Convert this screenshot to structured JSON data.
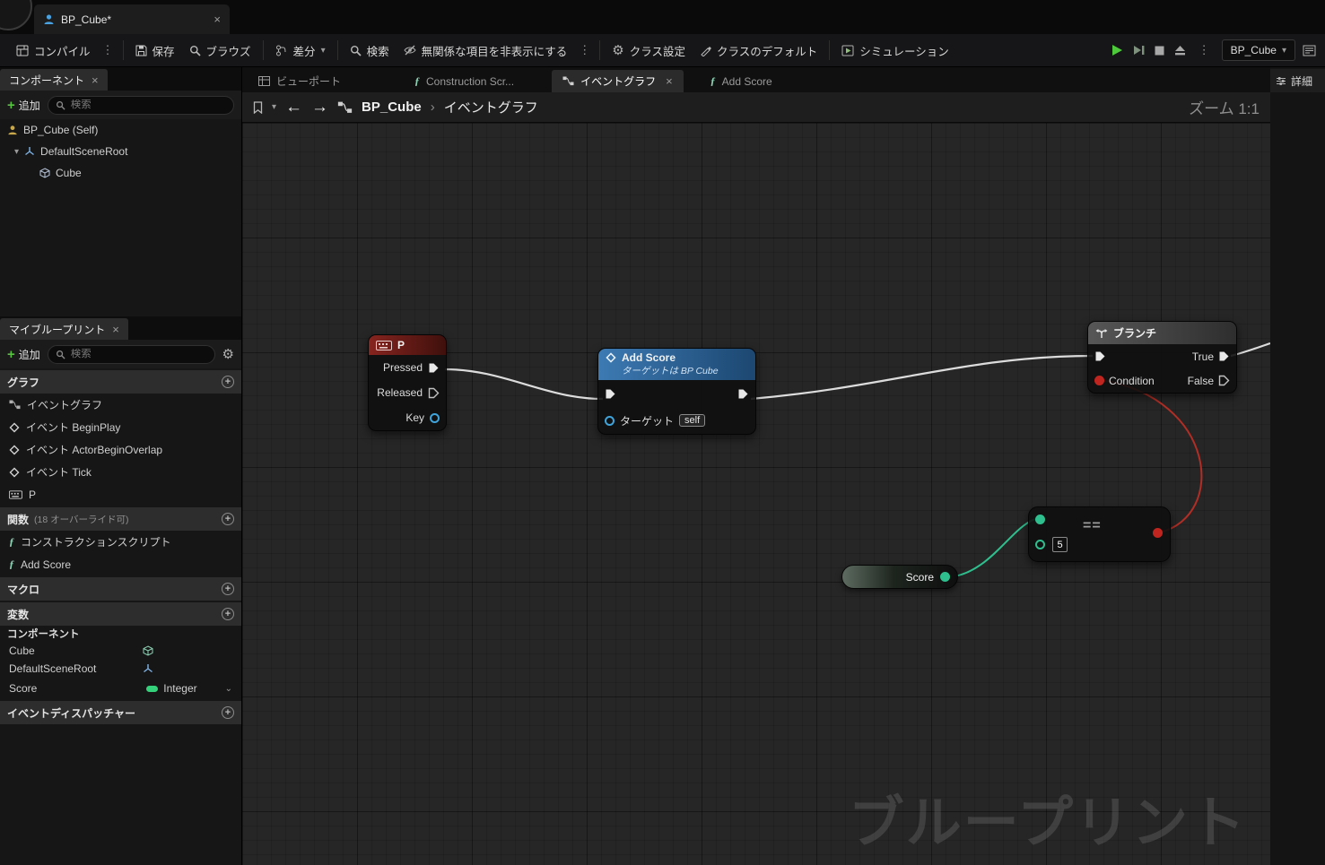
{
  "tabbar": {
    "doc_title": "BP_Cube*"
  },
  "toolbar": {
    "compile": "コンパイル",
    "save": "保存",
    "browse": "ブラウズ",
    "diff": "差分",
    "find": "検索",
    "hide_unrelated": "無関係な項目を非表示にする",
    "class_settings": "クラス設定",
    "class_defaults": "クラスのデフォルト",
    "simulation": "シミュレーション",
    "debug_target": "BP_Cube"
  },
  "components_panel": {
    "tab": "コンポーネント",
    "add": "追加",
    "search_placeholder": "検索",
    "items": [
      {
        "label": "BP_Cube (Self)"
      },
      {
        "label": "DefaultSceneRoot"
      },
      {
        "label": "Cube"
      }
    ]
  },
  "my_blueprint": {
    "tab": "マイブループリント",
    "add": "追加",
    "search_placeholder": "検索",
    "graph_section": "グラフ",
    "graph_items": [
      {
        "label": "イベントグラフ"
      },
      {
        "label": "イベント BeginPlay"
      },
      {
        "label": "イベント ActorBeginOverlap"
      },
      {
        "label": "イベント Tick"
      },
      {
        "label": "P"
      }
    ],
    "function_section": "関数",
    "function_note": "(18 オーバーライド可)",
    "function_items": [
      {
        "label": "コンストラクションスクリプト"
      },
      {
        "label": "Add Score"
      }
    ],
    "macro_section": "マクロ",
    "variable_section": "変数",
    "component_group": "コンポーネント",
    "variables": [
      {
        "label": "Cube"
      },
      {
        "label": "DefaultSceneRoot"
      }
    ],
    "score_variable": {
      "name": "Score",
      "type": "Integer"
    },
    "dispatcher_section": "イベントディスパッチャー"
  },
  "graph": {
    "tab_viewport": "ビューポート",
    "tab_construction": "Construction Scr...",
    "tab_event_graph": "イベントグラフ",
    "tab_add_score": "Add Score",
    "breadcrumb_root": "BP_Cube",
    "breadcrumb_current": "イベントグラフ",
    "zoom": "ズーム 1:1",
    "watermark": "ブループリント"
  },
  "details_panel": {
    "tab": "詳細"
  },
  "nodes": {
    "key_event": {
      "title": "P",
      "pressed": "Pressed",
      "released": "Released",
      "key": "Key"
    },
    "add_score": {
      "title": "Add Score",
      "subtitle": "ターゲットは BP Cube",
      "target_label": "ターゲット",
      "target_value": "self"
    },
    "branch": {
      "title": "ブランチ",
      "condition": "Condition",
      "true_label": "True",
      "false_label": "False"
    },
    "equals": {
      "operator": "==",
      "input_value": "5"
    },
    "score_getter": {
      "label": "Score"
    }
  },
  "colors": {
    "exec_wire": "#dcdcdc",
    "int_wire": "#2fbf8f",
    "bool_wire": "#b02e25",
    "play_green": "#4fc93c"
  }
}
